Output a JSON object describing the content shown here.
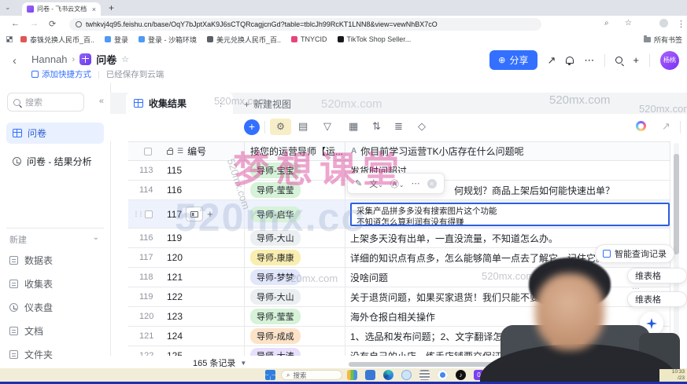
{
  "browser": {
    "tab_title": "问卷 - 飞书云文档",
    "new_tab": "+",
    "url": "twhkvj4q95.feishu.cn/base/OqY7bJptXaK9J6sCTQRcagjcnGd?table=tblcJh99RcKT1LNN8&view=vewNhBX7cO",
    "bookmarks": [
      {
        "label": "泰铢兑换人民币_百..",
        "color": "#e05656"
      },
      {
        "label": "登录",
        "color": "#4e9af5"
      },
      {
        "label": "登录 - 沙箱环境",
        "color": "#4e9af5"
      },
      {
        "label": "美元兑换人民币_百..",
        "color": "#5b5f66"
      },
      {
        "label": "TNYCID",
        "color": "#e8447a"
      },
      {
        "label": "TikTok Shop Seller...",
        "color": "#16181c"
      }
    ],
    "all_bookmarks": "所有书签"
  },
  "header": {
    "breadcrumb_parent": "Hannah",
    "doc_title": "问卷",
    "add_shortcut": "添加快捷方式",
    "saved_status": "已经保存到云端",
    "share_label": "分享",
    "share_color": "#3370ff",
    "avatar_name": "杨桃"
  },
  "sidebar": {
    "search_placeholder": "搜索",
    "items": [
      {
        "label": "问卷"
      },
      {
        "label": "问卷 - 结果分析"
      }
    ],
    "new_section": {
      "label": "新建",
      "items": [
        "数据表",
        "收集表",
        "仪表盘",
        "文档",
        "文件夹"
      ]
    }
  },
  "views": {
    "active_tab": "收集结果",
    "new_view": "新建视图"
  },
  "table": {
    "headers": {
      "no": "编号",
      "mentor": "接您的运营导师【运...",
      "question_icon": "A",
      "question": "你目前学习运营TK小店存在什么问题呢"
    },
    "tag_colors": {
      "green": "#d6f2d8",
      "gray": "#eceff1",
      "yellow": "#f9eeb0",
      "indigo": "#e2e6fb",
      "orange": "#fce3c8",
      "purple": "#e7dffc"
    },
    "rows": [
      {
        "idx": "113",
        "no": "115",
        "mentor": "导师-宝宝",
        "color": "green",
        "answer": "发货时间超过"
      },
      {
        "idx": "114",
        "no": "116",
        "mentor": "导师-莹莹",
        "color": "green",
        "answer": "何规划？商品上架后如何能快速出单？",
        "indent": true
      },
      {
        "no": "117",
        "mentor": "导师-启华",
        "color": "green",
        "selected": true,
        "answer_lines": [
          "采集产品拼多多没有搜索图片这个功能",
          "不知道怎么算利润有没有得赚"
        ]
      },
      {
        "idx": "116",
        "no": "119",
        "mentor": "导师-大山",
        "color": "gray",
        "answer": "上架多天没有出单，一直没流量，不知道怎么办。"
      },
      {
        "idx": "117",
        "no": "120",
        "mentor": "导师-康康",
        "color": "yellow",
        "answer": "详细的知识点有点多，怎么能够简单一点去了解它，记住它。"
      },
      {
        "idx": "118",
        "no": "121",
        "mentor": "导师-梦梦",
        "color": "indigo",
        "answer": "没啥问题"
      },
      {
        "idx": "119",
        "no": "122",
        "mentor": "导师-大山",
        "color": "gray",
        "answer": "关于退货问题，如果买家退货！我们只能不要货仅退款"
      },
      {
        "idx": "120",
        "no": "123",
        "mentor": "导师-莹莹",
        "color": "green",
        "answer": "海外仓报白相关操作"
      },
      {
        "idx": "121",
        "no": "124",
        "mentor": "导师-成成",
        "color": "orange",
        "answer": "1、选品和发布问题；2、文字翻译怎样转换；"
      },
      {
        "idx": "122",
        "no": "125",
        "mentor": "导师-大涛",
        "color": "purple",
        "answer": "没有自己的小店，练手店铺要交保证金吗？海外仓和..."
      }
    ],
    "footer_count": "165 条记录"
  },
  "floating": {
    "smart_query": "智能查询记录",
    "pill_top": "维表格",
    "pill_dots": "…",
    "pill_bottom": "维表格"
  },
  "watermarks": {
    "brand": "520mx.com",
    "big_pink": "梦想课堂",
    "big_blue": "520mx.co"
  },
  "taskbar": {
    "search_placeholder": "搜索",
    "clock_time": "10:33",
    "clock_date": "/23"
  }
}
